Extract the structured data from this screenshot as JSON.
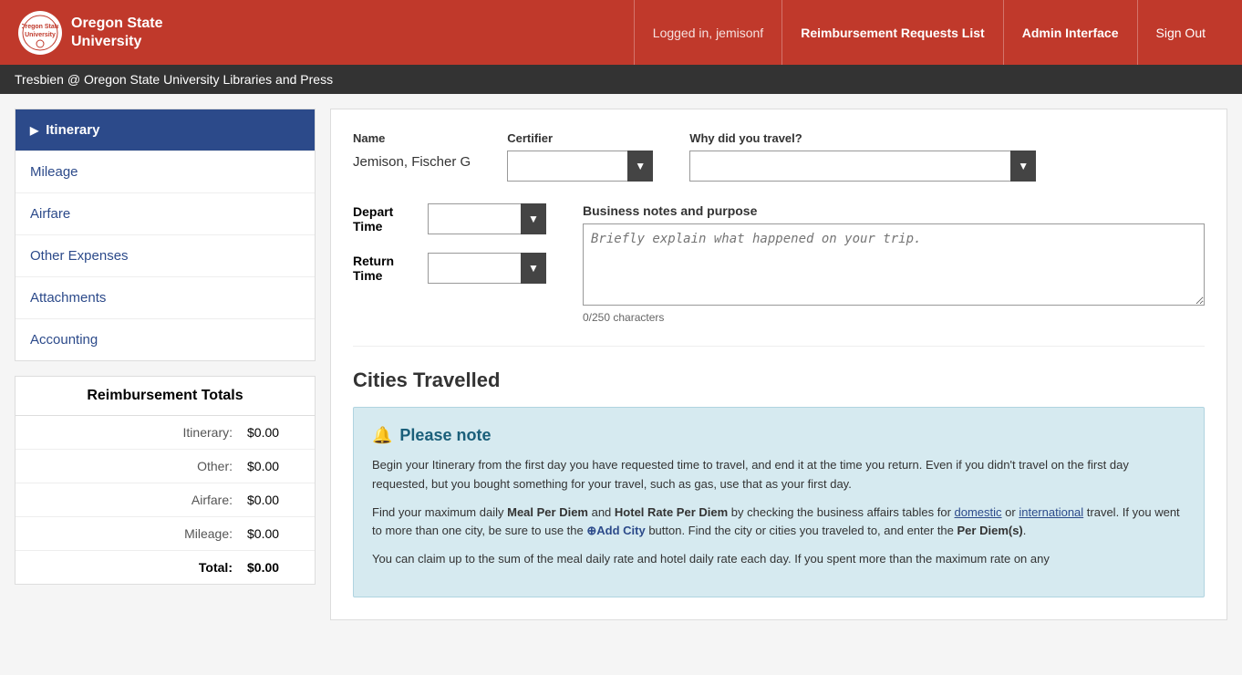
{
  "header": {
    "logo_line1": "Oregon State",
    "logo_line2": "University",
    "logo_abbr": "OSU",
    "logged_in_text": "Logged in, jemisonf",
    "nav": {
      "reimbursement": "Reimbursement Requests List",
      "admin": "Admin Interface",
      "signout": "Sign Out"
    }
  },
  "subheader": {
    "text": "Tresbien @ Oregon State University Libraries and Press"
  },
  "sidebar": {
    "items": [
      {
        "id": "itinerary",
        "label": "Itinerary",
        "active": true
      },
      {
        "id": "mileage",
        "label": "Mileage",
        "active": false
      },
      {
        "id": "airfare",
        "label": "Airfare",
        "active": false
      },
      {
        "id": "other-expenses",
        "label": "Other Expenses",
        "active": false
      },
      {
        "id": "attachments",
        "label": "Attachments",
        "active": false
      },
      {
        "id": "accounting",
        "label": "Accounting",
        "active": false
      }
    ]
  },
  "totals": {
    "title": "Reimbursement Totals",
    "rows": [
      {
        "label": "Itinerary:",
        "value": "$0.00"
      },
      {
        "label": "Other:",
        "value": "$0.00"
      },
      {
        "label": "Airfare:",
        "value": "$0.00"
      },
      {
        "label": "Mileage:",
        "value": "$0.00"
      }
    ],
    "total_label": "Total:",
    "total_value": "$0.00"
  },
  "form": {
    "name_label": "Name",
    "name_value": "Jemison, Fischer G",
    "certifier_label": "Certifier",
    "certifier_placeholder": "",
    "why_travel_label": "Why did you travel?",
    "why_travel_placeholder": "",
    "depart_label": "Depart",
    "time_label": "Time",
    "return_label": "Return",
    "business_notes_label": "Business notes and purpose",
    "business_notes_placeholder": "Briefly explain what happened on your trip.",
    "char_count": "0/250 characters"
  },
  "cities": {
    "title": "Cities Travelled",
    "note_title": "Please note",
    "note_para1": "Begin your Itinerary from the first day you have requested time to travel, and end it at the time you return. Even if you didn't travel on the first day requested, but you bought something for your travel, such as gas, use that as your first day.",
    "note_para2_before": "Find your maximum daily ",
    "note_meal": "Meal Per Diem",
    "note_and": " and ",
    "note_hotel": "Hotel Rate Per Diem",
    "note_para2_mid": " by checking the business affairs tables for ",
    "note_domestic": "domestic",
    "note_or": " or ",
    "note_international": "international",
    "note_para2_end": " travel. If you went to more than one city, be sure to use the ",
    "note_add_city": "Add City",
    "note_para2_final": " button. Find the city or cities you traveled to, and enter the ",
    "note_per_diem": "Per Diem(s)",
    "note_para2_dot": ".",
    "note_para3": "You can claim up to the sum of the meal daily rate and hotel daily rate each day. If you spent more than the maximum rate on any"
  }
}
